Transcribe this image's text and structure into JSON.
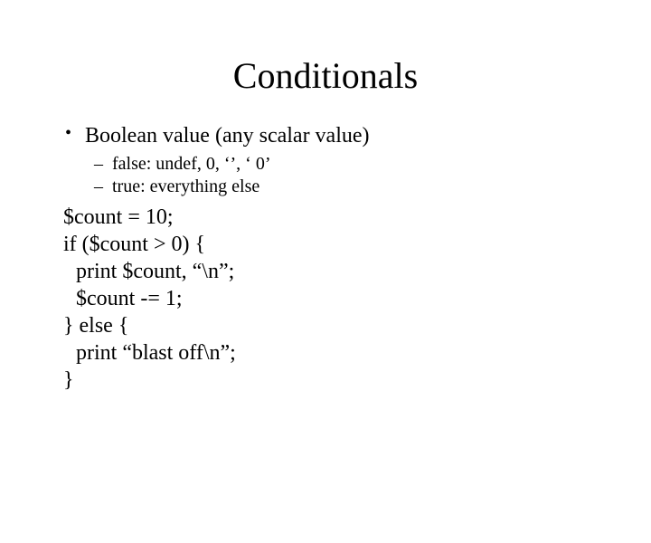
{
  "title": "Conditionals",
  "bullet1": "Boolean value (any scalar value)",
  "sub1": "false: undef, 0, ‘’, ‘ 0’",
  "sub2": "true: everything else",
  "code": {
    "l1": "$count = 10;",
    "l2": "if ($count > 0) {",
    "l3": "print $count, “\\n”;",
    "l4": "$count -= 1;",
    "l5": "} else {",
    "l6": "print “blast off\\n”;",
    "l7": "}"
  }
}
